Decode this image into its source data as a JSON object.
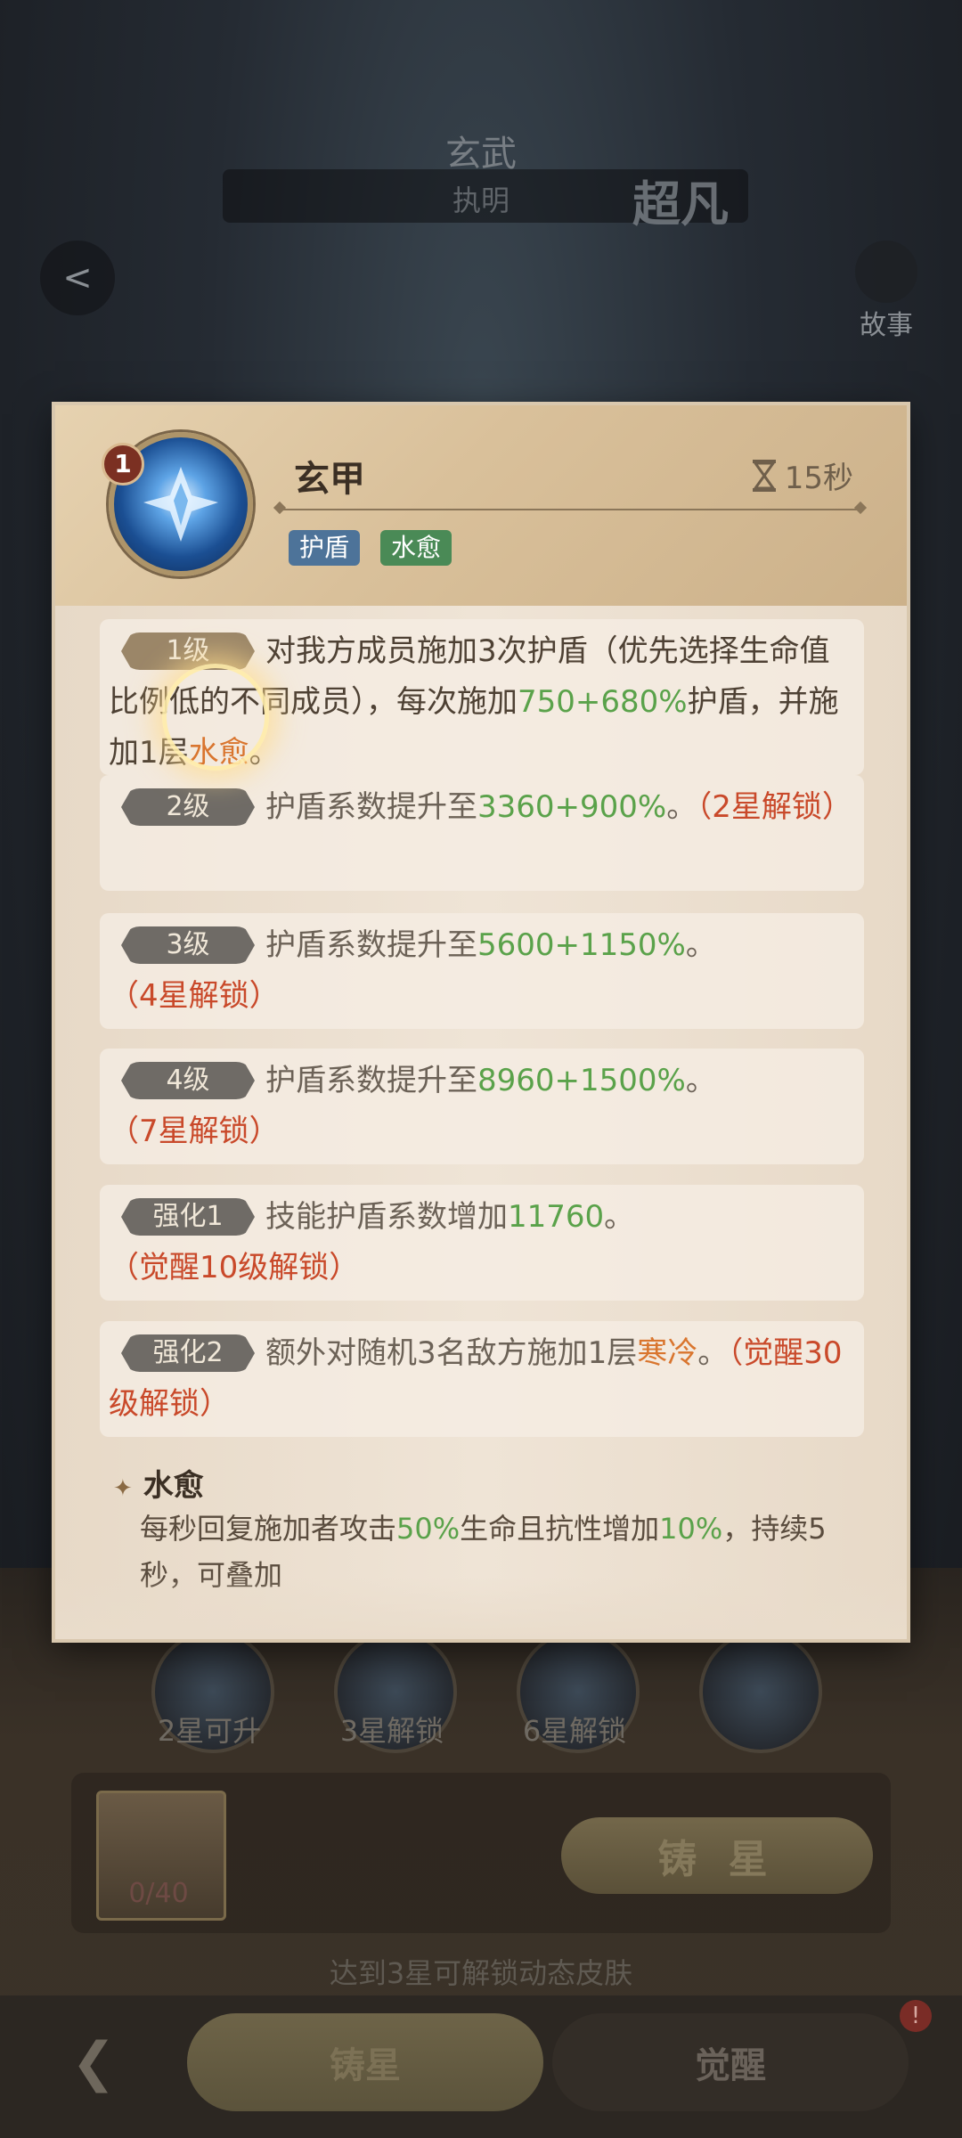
{
  "background": {
    "title": "玄武",
    "subtitle": "执明",
    "rank": "超凡",
    "story_label": "故事",
    "lower_skills": [
      {
        "label": "2星可升"
      },
      {
        "label": "3星解锁"
      },
      {
        "label": "6星解锁"
      },
      {
        "label": ""
      }
    ],
    "shard_count": "0/40",
    "forge_button": "铸 星",
    "unlock_hint": "达到3星可解锁动态皮肤",
    "nav": {
      "forge": "铸星",
      "awaken": "觉醒",
      "alert": "!"
    }
  },
  "skill": {
    "level_badge": "1",
    "name": "玄甲",
    "cooldown": "15秒",
    "tags": [
      "护盾",
      "水愈"
    ],
    "entries": [
      {
        "pill": "1级",
        "active": true,
        "parts": [
          {
            "t": "对我方成员施加3次护盾（优先选择生命值比例低的不同成员），每次施加"
          },
          {
            "t": "750+680%",
            "c": "g"
          },
          {
            "t": "护盾，并施加1层"
          },
          {
            "t": "水愈",
            "c": "o"
          },
          {
            "t": "。"
          }
        ]
      },
      {
        "pill": "2级",
        "active": false,
        "parts": [
          {
            "t": "护盾系数提升至"
          },
          {
            "t": "3360+900%",
            "c": "g"
          },
          {
            "t": "。"
          },
          {
            "t": "（2星解锁）",
            "c": "r"
          }
        ]
      },
      {
        "pill": "3级",
        "active": false,
        "parts": [
          {
            "t": "护盾系数提升至"
          },
          {
            "t": "5600+1150%",
            "c": "g"
          },
          {
            "t": "。"
          },
          {
            "t": "（4星解锁）",
            "c": "r"
          }
        ]
      },
      {
        "pill": "4级",
        "active": false,
        "parts": [
          {
            "t": "护盾系数提升至"
          },
          {
            "t": "8960+1500%",
            "c": "g"
          },
          {
            "t": "。"
          },
          {
            "t": "（7星解锁）",
            "c": "r"
          }
        ]
      },
      {
        "pill": "强化1",
        "active": false,
        "parts": [
          {
            "t": "技能护盾系数增加"
          },
          {
            "t": "11760",
            "c": "g"
          },
          {
            "t": "。"
          },
          {
            "t": "（觉醒10级解锁）",
            "c": "r"
          }
        ]
      },
      {
        "pill": "强化2",
        "active": false,
        "parts": [
          {
            "t": "额外对随机3名敌方施加1层"
          },
          {
            "t": "寒冷",
            "c": "o"
          },
          {
            "t": "。"
          },
          {
            "t": "（觉醒30级解锁）",
            "c": "r"
          }
        ]
      }
    ],
    "note": {
      "title": "水愈",
      "parts": [
        {
          "t": "每秒回复施加者攻击"
        },
        {
          "t": "50%",
          "c": "g"
        },
        {
          "t": "生命且抗性增加"
        },
        {
          "t": "10%",
          "c": "g"
        },
        {
          "t": "，持续5秒，可叠加"
        }
      ]
    }
  },
  "colors": {
    "panel_bg": "#e9dccb",
    "value_green": "#5aa24a",
    "keyword_orange": "#d9752e",
    "lock_red": "#c9492a",
    "shield_tag": "#4d7399",
    "heal_tag": "#4a8a56"
  }
}
